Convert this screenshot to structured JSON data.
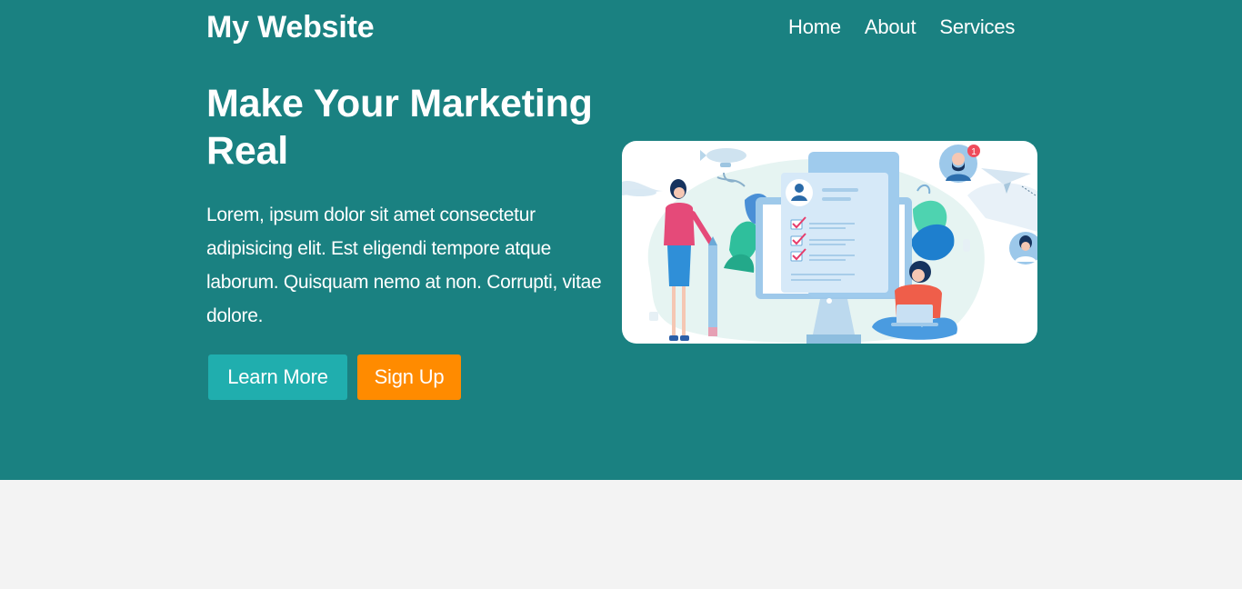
{
  "navbar": {
    "logo": "My Website",
    "links": [
      {
        "label": "Home"
      },
      {
        "label": "About"
      },
      {
        "label": "Services"
      }
    ]
  },
  "hero": {
    "headline": "Make Your Marketing Real",
    "lede": "Lorem, ipsum dolor sit amet consectetur adipisicing elit. Est eligendi tempore atque laborum. Quisquam nemo at non. Corrupti, vitae dolore.",
    "buttons": {
      "learn_more": "Learn More",
      "sign_up": "Sign Up"
    },
    "notification_count": "1"
  },
  "colors": {
    "hero_bg": "#1a8181",
    "page_bg": "#f3f3f3",
    "learn_more_bg": "#20aeae",
    "sign_up_bg": "#ff8b00"
  }
}
